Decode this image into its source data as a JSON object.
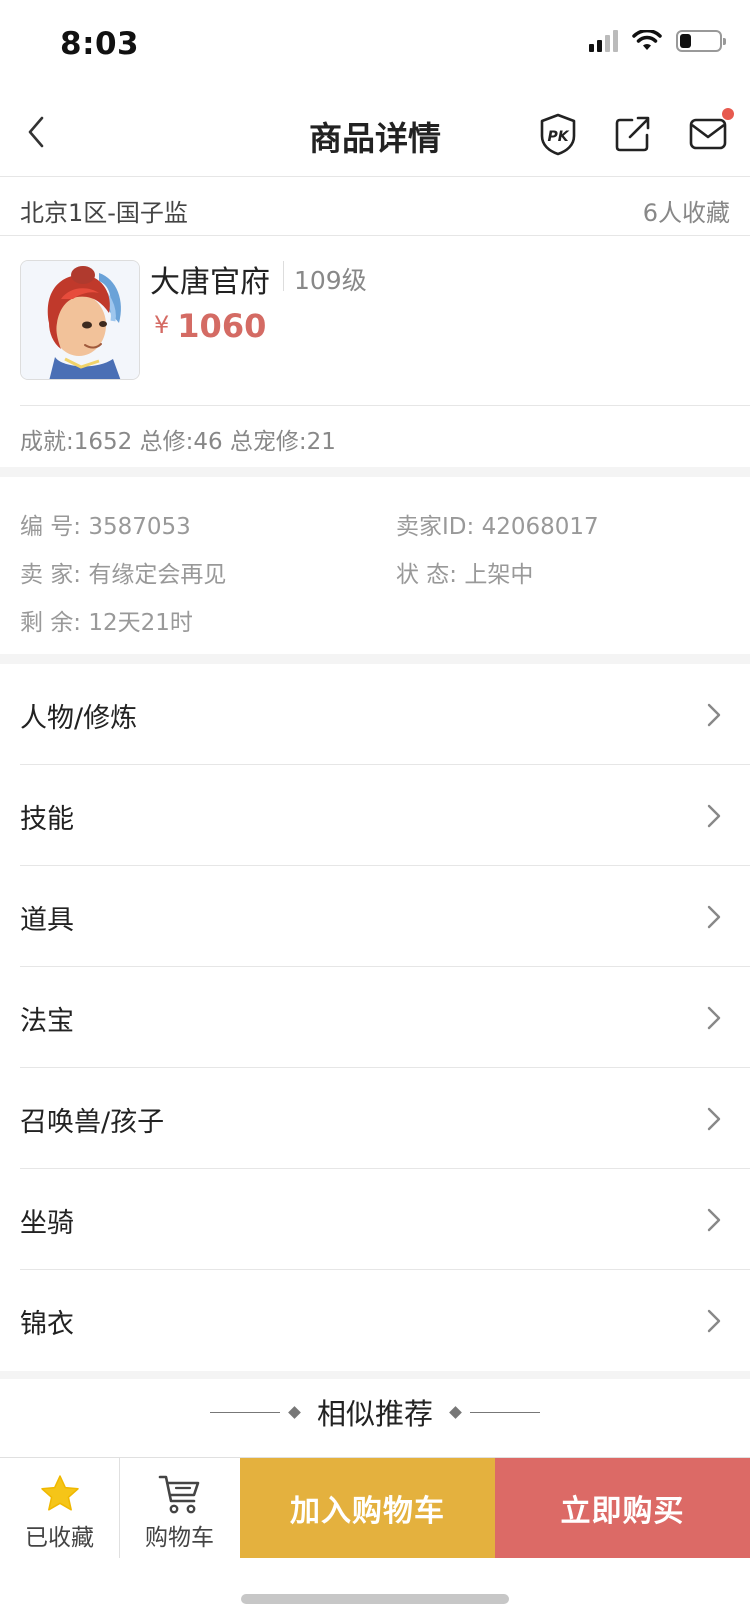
{
  "status_bar": {
    "time": "8:03"
  },
  "header": {
    "title": "商品详情"
  },
  "server": {
    "name": "北京1区-国子监",
    "favorites": "6人收藏"
  },
  "character": {
    "school": "大唐官府",
    "level": "109级",
    "currency": "¥",
    "price": "1060"
  },
  "stats": {
    "text": "成就:1652 总修:46 总宠修:21"
  },
  "info": {
    "id_label": "编 号:",
    "id_value": "3587053",
    "seller_id_label": "卖家ID:",
    "seller_id_value": "42068017",
    "seller_label": "卖 家:",
    "seller_value": "有缘定会再见",
    "status_label": "状 态:",
    "status_value": "上架中",
    "remain_label": "剩 余:",
    "remain_value": "12天21时"
  },
  "menu": {
    "items": [
      {
        "label": "人物/修炼"
      },
      {
        "label": "技能"
      },
      {
        "label": "道具"
      },
      {
        "label": "法宝"
      },
      {
        "label": "召唤兽/孩子"
      },
      {
        "label": "坐骑"
      },
      {
        "label": "锦衣"
      }
    ]
  },
  "similar": {
    "title": "相似推荐"
  },
  "bottom_bar": {
    "favorited_label": "已收藏",
    "cart_label": "购物车",
    "add_to_cart_label": "加入购物车",
    "buy_now_label": "立即购买"
  },
  "colors": {
    "price": "#d46b64",
    "add_to_cart": "#e4b13e",
    "buy_now": "#dc6a66",
    "notification_dot": "#e75a4f",
    "star": "#f5c518"
  },
  "icons": [
    "back-icon",
    "pk-icon",
    "share-icon",
    "mail-icon",
    "chevron-right-icon",
    "star-icon",
    "cart-icon"
  ]
}
